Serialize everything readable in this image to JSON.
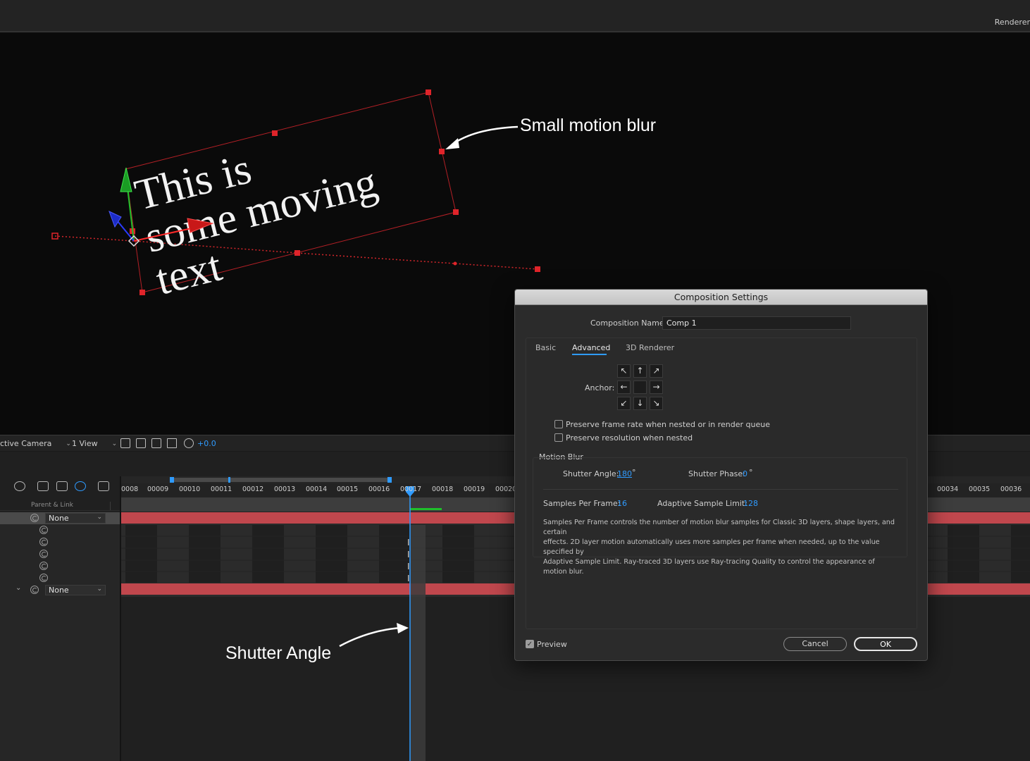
{
  "app": {
    "renderer_label": "Renderer"
  },
  "viewer": {
    "text_lines": [
      "This is",
      "some moving",
      "text"
    ],
    "annotation_blur": "Small motion blur"
  },
  "viewer_toolbar": {
    "camera": "ctive Camera",
    "view": "1 View",
    "exposure": "+0.0"
  },
  "timeline": {
    "column_header": "Parent & Link",
    "ruler_labels": [
      "0008",
      "00009",
      "00010",
      "00011",
      "00012",
      "00013",
      "00014",
      "00015",
      "00016",
      "00017",
      "00018",
      "00019",
      "00020",
      "00034",
      "00035",
      "00036"
    ],
    "layer_rows": [
      {
        "parent": "None",
        "selected": true
      },
      {
        "parent": null
      },
      {
        "parent": null
      },
      {
        "parent": null
      },
      {
        "parent": null
      },
      {
        "parent": null
      },
      {
        "parent": "None",
        "selected": false
      }
    ],
    "annotation_shutter": "Shutter Angle"
  },
  "dialog": {
    "title": "Composition Settings",
    "comp_name_label": "Composition Name:",
    "comp_name_value": "Comp 1",
    "tabs": [
      "Basic",
      "Advanced",
      "3D Renderer"
    ],
    "active_tab": "Advanced",
    "anchor_label": "Anchor:",
    "preserve_frame_rate": "Preserve frame rate when nested or in render queue",
    "preserve_resolution": "Preserve resolution when nested",
    "motion_blur": {
      "title": "Motion Blur",
      "shutter_angle_label": "Shutter Angle:",
      "shutter_angle_value": "180",
      "shutter_phase_label": "Shutter Phase:",
      "shutter_phase_value": "0",
      "degree": "°",
      "samples_label": "Samples Per Frame:",
      "samples_value": "16",
      "adaptive_label": "Adaptive Sample Limit:",
      "adaptive_value": "128",
      "description_lines": [
        "Samples Per Frame controls the number of motion blur samples for Classic 3D layers, shape layers, and certain",
        "effects. 2D layer motion automatically uses more samples per frame when needed, up to the value specified by",
        "Adaptive Sample Limit. Ray-traced 3D layers use Ray-tracing Quality to control the appearance of motion blur."
      ]
    },
    "preview_label": "Preview",
    "preview_checked": true,
    "cancel_label": "Cancel",
    "ok_label": "OK"
  },
  "colors": {
    "accent": "#2f9bff",
    "layer_bar": "#c0474d",
    "handle": "#e0242a"
  }
}
